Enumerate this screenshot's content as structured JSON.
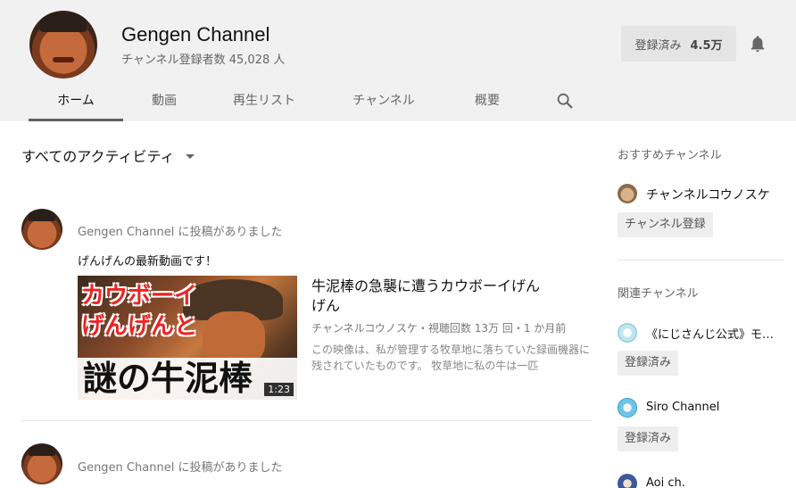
{
  "header": {
    "channel_name": "Gengen Channel",
    "subscribers_text": "チャンネル登録者数 45,028 人",
    "subscribe_button": {
      "label": "登録済み",
      "count": "4.5万"
    },
    "tabs": [
      "ホーム",
      "動画",
      "再生リスト",
      "チャンネル",
      "概要"
    ],
    "active_tab": "ホーム"
  },
  "main": {
    "activity_filter": "すべてのアクティビティ",
    "posts": [
      {
        "author": "Gengen Channel",
        "action": " に投稿がありました",
        "text": "げんげんの最新動画です！",
        "video": {
          "title": "牛泥棒の急襲に遭うカウボーイげんげん",
          "meta": "チャンネルコウノスケ・視聴回数 13万 回・1 か月前",
          "description": "この映像は、私が管理する牧草地に落ちていた録画機器に残されていたものです。 牧草地に私の牛は一匹",
          "duration": "1:23",
          "thumb_line1": "カウボーイ",
          "thumb_line2": "げんげんと",
          "thumb_line3": "謎の牛泥棒"
        }
      },
      {
        "author": "Gengen Channel",
        "action": " に投稿がありました"
      }
    ]
  },
  "sidebar": {
    "featured_heading": "おすすめチャンネル",
    "featured": [
      {
        "name": "チャンネルコウノスケ",
        "button": "チャンネル登録"
      }
    ],
    "related_heading": "関連チャンネル",
    "related": [
      {
        "name": "《にじさんじ公式》モ…",
        "button": "登録済み"
      },
      {
        "name": "Siro Channel",
        "button": "登録済み"
      },
      {
        "name": "Aoi ch."
      }
    ]
  },
  "colors": {
    "header_bg": "#f1f1f1",
    "thumb_red_text": "#e22222",
    "active_tab_underline": "#606060"
  }
}
